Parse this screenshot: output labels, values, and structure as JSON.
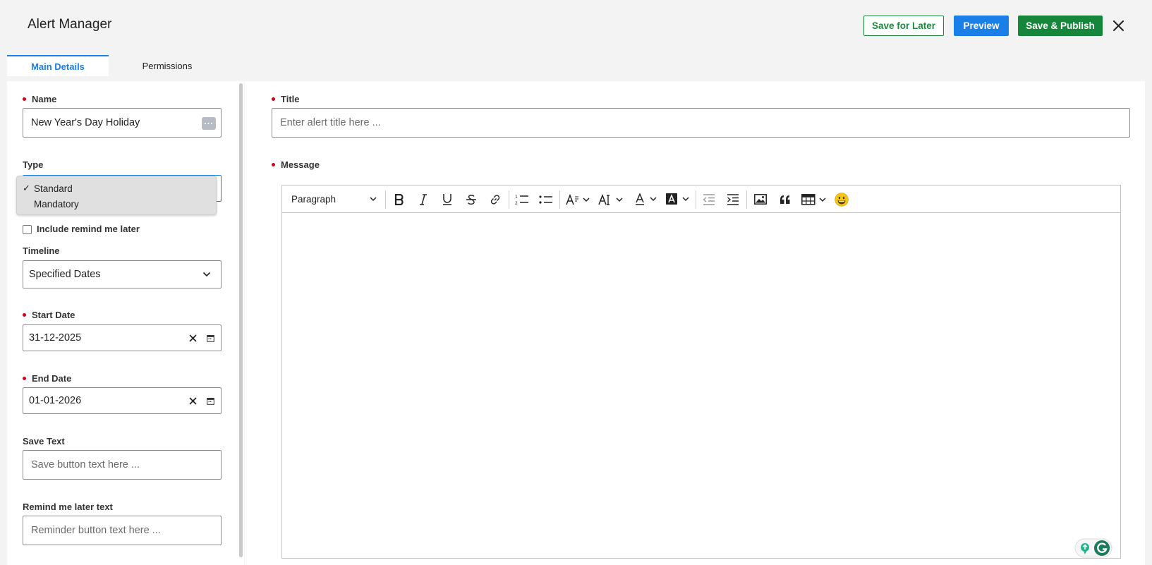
{
  "app": {
    "title": "Alert Manager"
  },
  "header": {
    "save_later_label": "Save for Later",
    "preview_label": "Preview",
    "publish_label": "Save & Publish"
  },
  "tabs": [
    {
      "label": "Main Details",
      "active": true
    },
    {
      "label": "Permissions",
      "active": false
    }
  ],
  "form": {
    "name": {
      "label": "Name",
      "value": "New Year's Day Holiday"
    },
    "type": {
      "label": "Type",
      "options": [
        {
          "label": "Standard",
          "selected": true,
          "check": "✓"
        },
        {
          "label": "Mandatory",
          "selected": false
        }
      ]
    },
    "remind": {
      "label": "Include remind me later",
      "checked": false
    },
    "timeline": {
      "label": "Timeline",
      "value": "Specified Dates"
    },
    "start_date": {
      "label": "Start Date",
      "value": "31-12-2025"
    },
    "end_date": {
      "label": "End Date",
      "value": "01-01-2026"
    },
    "save_text": {
      "label": "Save Text",
      "placeholder": "Save button text here ..."
    },
    "remind_text": {
      "label": "Remind me later text",
      "placeholder": "Reminder button text here ..."
    },
    "title": {
      "label": "Title",
      "placeholder": "Enter alert title here ..."
    },
    "message": {
      "label": "Message"
    }
  },
  "editor": {
    "block_format": "Paragraph",
    "tools": [
      "bold",
      "italic",
      "underline",
      "strikethrough",
      "link",
      "numbered-list",
      "bulleted-list",
      "heading",
      "font-size",
      "font-color",
      "font-background-color",
      "outdent",
      "indent",
      "image",
      "block-quote",
      "table",
      "emoji"
    ]
  },
  "colors": {
    "accent_blue": "#1a7fe6",
    "accent_green": "#16873a",
    "required_dot": "#d0021b"
  }
}
